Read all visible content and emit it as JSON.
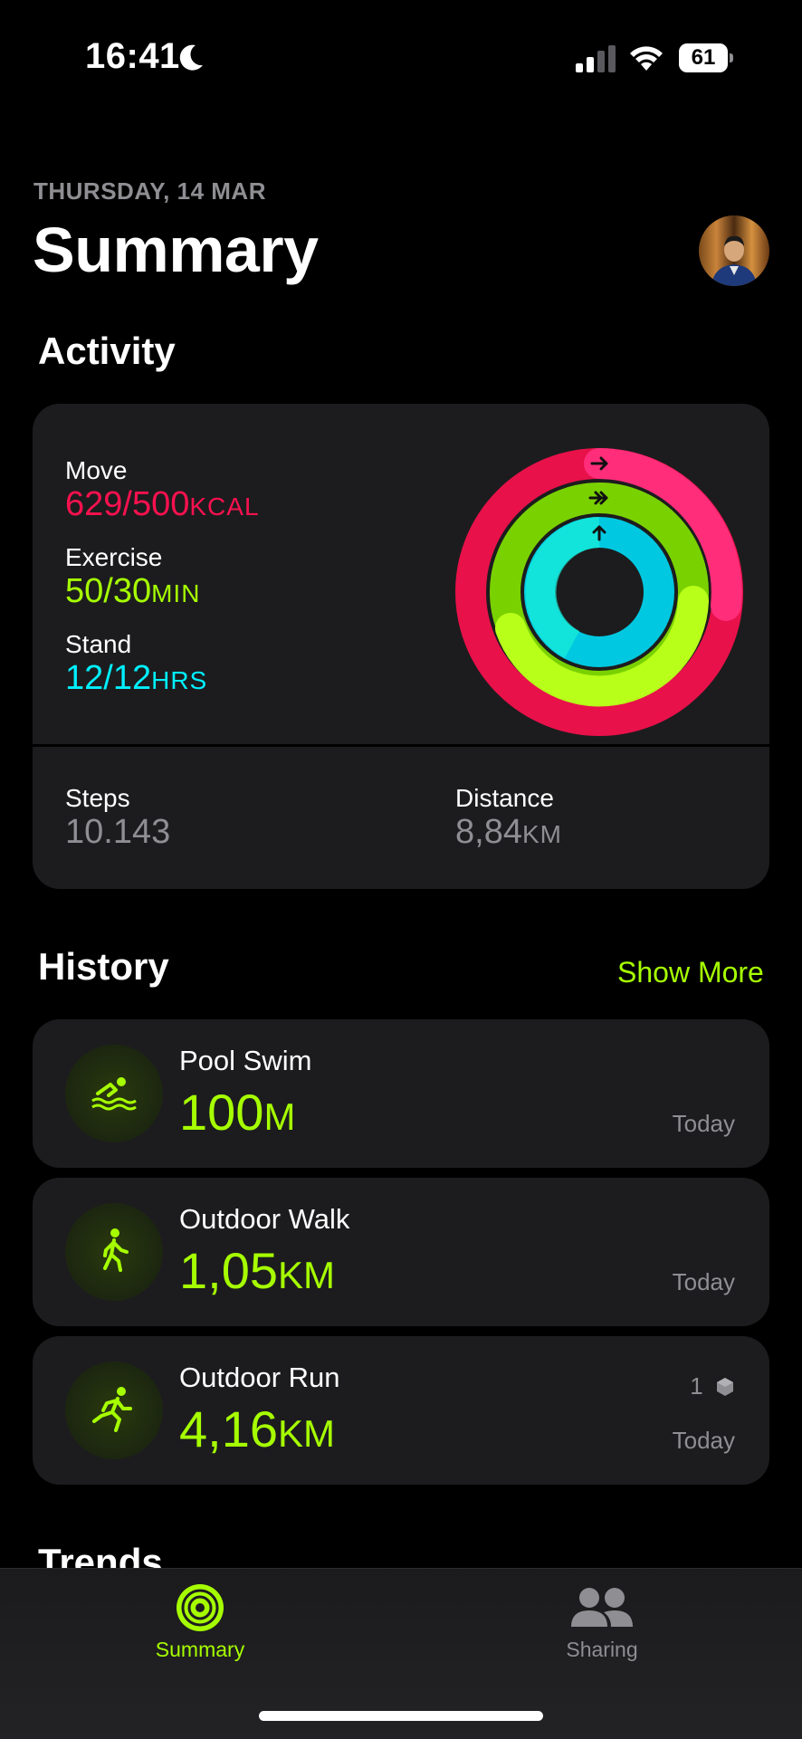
{
  "status_bar": {
    "time": "16:41",
    "battery": "61"
  },
  "header": {
    "date": "THURSDAY, 14 MAR",
    "title": "Summary"
  },
  "activity": {
    "title": "Activity",
    "move": {
      "label": "Move",
      "value": "629/500",
      "unit": "KCAL",
      "progress": 1.258
    },
    "exercise": {
      "label": "Exercise",
      "value": "50/30",
      "unit": "MIN",
      "progress": 1.667
    },
    "stand": {
      "label": "Stand",
      "value": "12/12",
      "unit": "HRS",
      "progress": 1.0
    },
    "steps": {
      "label": "Steps",
      "value": "10.143"
    },
    "distance": {
      "label": "Distance",
      "value": "8,84",
      "unit": "KM"
    }
  },
  "history": {
    "title": "History",
    "show_more": "Show More",
    "workouts": [
      {
        "name": "Pool Swim",
        "value": "100",
        "unit": "M",
        "date": "Today",
        "icon": "swim-icon"
      },
      {
        "name": "Outdoor Walk",
        "value": "1,05",
        "unit": "KM",
        "date": "Today",
        "icon": "walk-icon"
      },
      {
        "name": "Outdoor Run",
        "value": "4,16",
        "unit": "KM",
        "date": "Today",
        "badge": "1",
        "icon": "run-icon"
      }
    ]
  },
  "trends": {
    "title": "Trends"
  },
  "tabs": [
    {
      "label": "Summary",
      "active": true
    },
    {
      "label": "Sharing",
      "active": false
    }
  ],
  "colors": {
    "move": "#fa114f",
    "exercise": "#a6ff00",
    "stand": "#00f0ff",
    "accent": "#a6ff00"
  }
}
